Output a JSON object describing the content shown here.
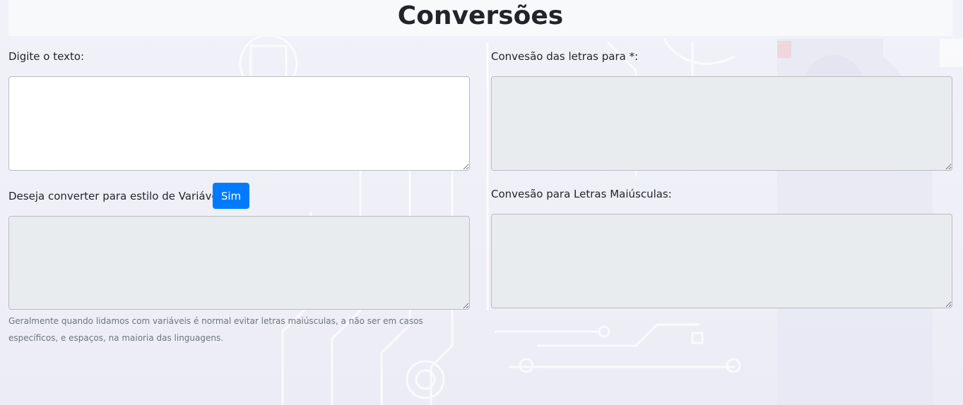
{
  "page": {
    "title": "Conversões"
  },
  "input": {
    "label": "Digite o texto:",
    "value": ""
  },
  "variable_style": {
    "question": "Deseja converter para estilo de Variável?",
    "button_label": "Sim",
    "output_value": "",
    "help_text": "Geralmente quando lidamos com variáveis é normal evitar letras maiúsculas, a não ser em casos específicos, e espaços, na maioria das linguagens."
  },
  "asterisk_conversion": {
    "label": "Convesão das letras para *:",
    "output_value": ""
  },
  "uppercase_conversion": {
    "label": "Convesão para Letras Maiúsculas:",
    "output_value": ""
  },
  "colors": {
    "primary_button": "#007bff",
    "readonly_field": "#e9ecef",
    "header_bg": "#f8f9fa"
  }
}
